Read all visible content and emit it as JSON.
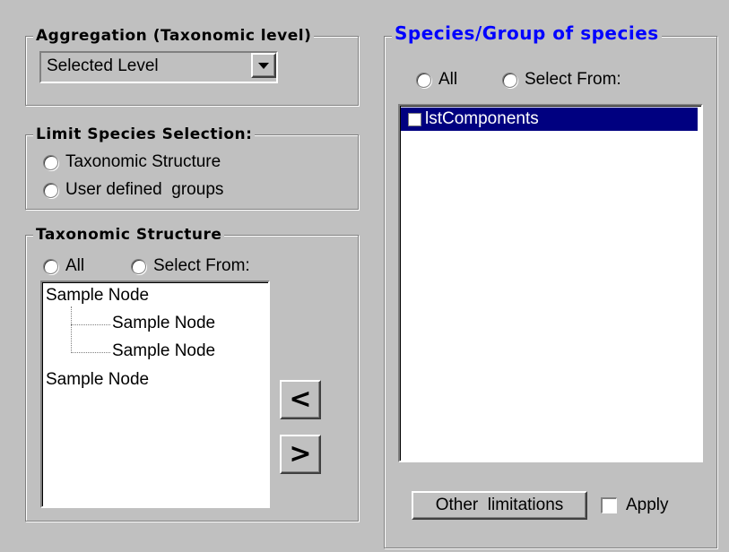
{
  "aggregation": {
    "legend": "Aggregation (Taxonomic level)",
    "selected": "Selected Level"
  },
  "limit": {
    "legend": "Limit Species Selection:",
    "options": [
      "Taxonomic Structure",
      "User defined  groups"
    ]
  },
  "taxonomic": {
    "legend": "Taxonomic Structure",
    "radio_all": "All",
    "radio_select": "Select From:",
    "tree": [
      "Sample Node",
      "Sample Node",
      "Sample Node",
      "Sample Node"
    ]
  },
  "move": {
    "left": "<",
    "right": ">"
  },
  "species": {
    "legend": "Species/Group of species",
    "radio_all": "All",
    "radio_select": "Select From:",
    "list_item": "lstComponents"
  },
  "bottom": {
    "other_button": "Other  limitations",
    "apply_label": "Apply"
  },
  "colors": {
    "face": "#c0c0c0",
    "highlight": "#000080",
    "legend_blue": "#0000ff"
  }
}
